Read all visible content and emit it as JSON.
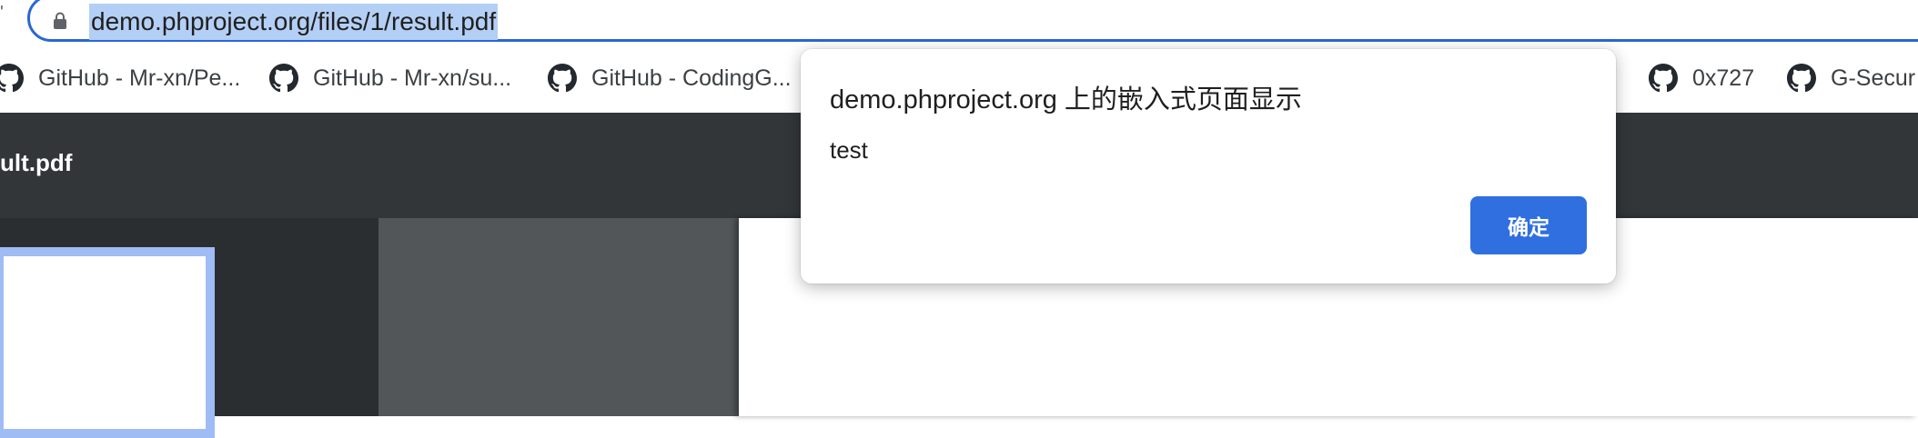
{
  "browser": {
    "url": "demo.phproject.org/files/1/result.pdf",
    "icons": {
      "lock": "lock-icon",
      "bookmark": "github-icon"
    }
  },
  "bookmarks": [
    {
      "label": "GitHub - Mr-xn/Pe..."
    },
    {
      "label": "GitHub - Mr-xn/su..."
    },
    {
      "label": "GitHub - CodingG..."
    },
    {
      "label": "0x727"
    },
    {
      "label": "G-Secur"
    }
  ],
  "pdf_viewer": {
    "title": "ult.pdf"
  },
  "dialog": {
    "title": "demo.phproject.org 上的嵌入式页面显示",
    "message": "test",
    "ok_label": "确定"
  },
  "colors": {
    "accent": "#2f6fe0",
    "toolbar": "#323639",
    "selection": "#b4cff5"
  }
}
